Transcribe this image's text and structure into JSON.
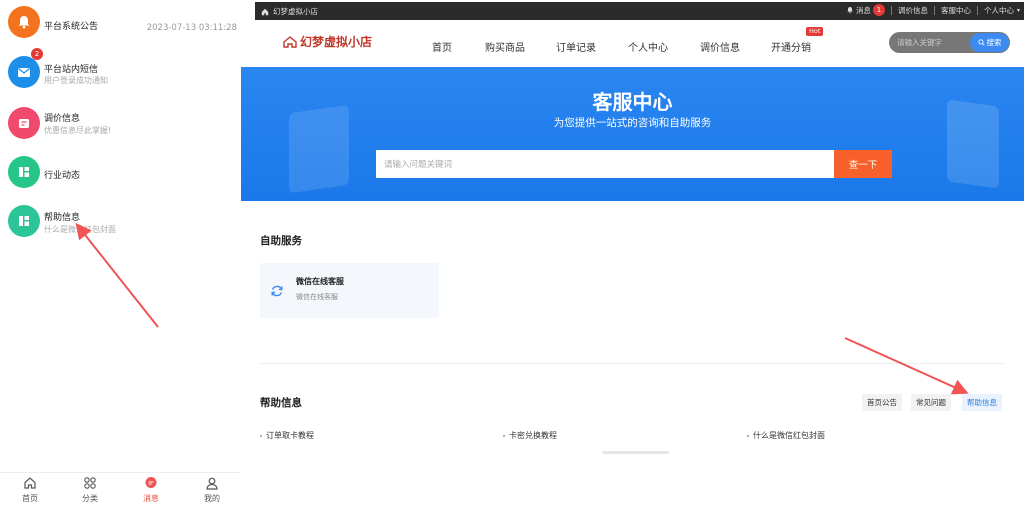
{
  "mobile": {
    "messages": [
      {
        "title": "平台系统公告",
        "subtitle": "",
        "time": "2023-07-13 03:11:28",
        "color": "#f4731f"
      },
      {
        "title": "平台站内短信",
        "subtitle": "用户登录成功通知",
        "time": "",
        "badge": "2",
        "color": "#1e8fe8"
      },
      {
        "title": "调价信息",
        "subtitle": "优惠信息尽此掌握!",
        "time": "",
        "color": "#ef4a6b"
      },
      {
        "title": "行业动态",
        "subtitle": "",
        "time": "",
        "color": "#26c58a"
      },
      {
        "title": "帮助信息",
        "subtitle": "什么是微信红包封面",
        "time": "",
        "color": "#2cc597"
      }
    ],
    "tabs": [
      {
        "label": "首页",
        "icon": "home-icon"
      },
      {
        "label": "分类",
        "icon": "category-icon"
      },
      {
        "label": "消息",
        "icon": "message-icon",
        "active": true
      },
      {
        "label": "我的",
        "icon": "user-icon"
      }
    ]
  },
  "site": {
    "topbar": {
      "home_label": "幻梦虚拟小店",
      "messages_label": "消息",
      "messages_count": "1",
      "links": [
        "调价信息",
        "客服中心",
        "个人中心"
      ]
    },
    "header": {
      "logo_text": "幻梦虚拟小店",
      "nav": [
        "首页",
        "购买商品",
        "订单记录",
        "个人中心",
        "调价信息",
        "开通分销"
      ],
      "hot_label": "Hot",
      "search_placeholder": "请输入关键字",
      "search_button": "搜索"
    },
    "banner": {
      "title": "客服中心",
      "subtitle": "为您提供一站式的咨询和自助服务",
      "search_placeholder": "请输入问题关键词",
      "search_button": "查一下"
    },
    "self_service": {
      "title": "自助服务",
      "card_title": "微信在线客服",
      "card_subtitle": "微信在线客服"
    },
    "help": {
      "title": "帮助信息",
      "tabs": [
        "首页公告",
        "常见问题",
        "帮助信息"
      ],
      "active_tab": "帮助信息",
      "links": [
        "订单取卡教程",
        "卡密兑换教程",
        "什么是微信红包封面"
      ]
    }
  },
  "colors": {
    "accent_blue": "#1a78ea",
    "search_orange": "#f7602a",
    "arrow_red": "#f05454"
  }
}
